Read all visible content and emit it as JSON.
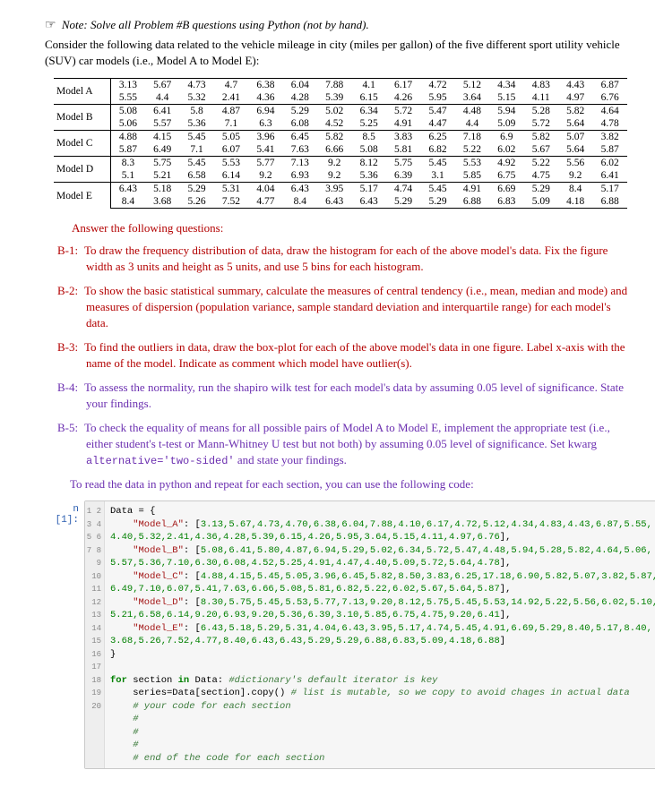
{
  "note": "Note: Solve all Problem #B questions using Python (not by hand).",
  "intro": "Consider the following data related to the vehicle mileage in city (miles per gallon) of the five different sport utility vehicle (SUV) car models (i.e., Model A to Model E):",
  "table": {
    "rows": [
      {
        "label": "Model A",
        "r1": [
          "3.13",
          "5.67",
          "4.73",
          "4.7",
          "6.38",
          "6.04",
          "7.88",
          "4.1",
          "6.17",
          "4.72",
          "5.12",
          "4.34",
          "4.83",
          "4.43",
          "6.87"
        ],
        "r2": [
          "5.55",
          "4.4",
          "5.32",
          "2.41",
          "4.36",
          "4.28",
          "5.39",
          "6.15",
          "4.26",
          "5.95",
          "3.64",
          "5.15",
          "4.11",
          "4.97",
          "6.76"
        ]
      },
      {
        "label": "Model B",
        "r1": [
          "5.08",
          "6.41",
          "5.8",
          "4.87",
          "6.94",
          "5.29",
          "5.02",
          "6.34",
          "5.72",
          "5.47",
          "4.48",
          "5.94",
          "5.28",
          "5.82",
          "4.64"
        ],
        "r2": [
          "5.06",
          "5.57",
          "5.36",
          "7.1",
          "6.3",
          "6.08",
          "4.52",
          "5.25",
          "4.91",
          "4.47",
          "4.4",
          "5.09",
          "5.72",
          "5.64",
          "4.78"
        ]
      },
      {
        "label": "Model C",
        "r1": [
          "4.88",
          "4.15",
          "5.45",
          "5.05",
          "3.96",
          "6.45",
          "5.82",
          "8.5",
          "3.83",
          "6.25",
          "7.18",
          "6.9",
          "5.82",
          "5.07",
          "3.82"
        ],
        "r2": [
          "5.87",
          "6.49",
          "7.1",
          "6.07",
          "5.41",
          "7.63",
          "6.66",
          "5.08",
          "5.81",
          "6.82",
          "5.22",
          "6.02",
          "5.67",
          "5.64",
          "5.87"
        ]
      },
      {
        "label": "Model D",
        "r1": [
          "8.3",
          "5.75",
          "5.45",
          "5.53",
          "5.77",
          "7.13",
          "9.2",
          "8.12",
          "5.75",
          "5.45",
          "5.53",
          "4.92",
          "5.22",
          "5.56",
          "6.02"
        ],
        "r2": [
          "5.1",
          "5.21",
          "6.58",
          "6.14",
          "9.2",
          "6.93",
          "9.2",
          "5.36",
          "6.39",
          "3.1",
          "5.85",
          "6.75",
          "4.75",
          "9.2",
          "6.41"
        ]
      },
      {
        "label": "Model E",
        "r1": [
          "6.43",
          "5.18",
          "5.29",
          "5.31",
          "4.04",
          "6.43",
          "3.95",
          "5.17",
          "4.74",
          "5.45",
          "4.91",
          "6.69",
          "5.29",
          "8.4",
          "5.17"
        ],
        "r2": [
          "8.4",
          "3.68",
          "5.26",
          "7.52",
          "4.77",
          "8.4",
          "6.43",
          "6.43",
          "5.29",
          "5.29",
          "6.88",
          "6.83",
          "5.09",
          "4.18",
          "6.88"
        ]
      }
    ]
  },
  "answer_header": "Answer the following questions:",
  "questions": [
    {
      "id": "B-1:",
      "cls": "q-red",
      "text": "To draw the frequency distribution of data, draw the histogram for each of the above model's data. Fix the figure width as 3 units and height as 5 units, and use 5 bins for each histogram."
    },
    {
      "id": "B-2:",
      "cls": "q-red",
      "text": "To show the basic statistical summary, calculate the measures of central tendency (i.e., mean, median and mode) and measures of dispersion (population variance, sample standard deviation and interquartile range) for each model's data."
    },
    {
      "id": "B-3:",
      "cls": "q-red",
      "text": "To find the outliers in data, draw the box-plot for each of the above model's data in one figure. Label x-axis with the name of the model. Indicate as comment which model have outlier(s)."
    },
    {
      "id": "B-4:",
      "cls": "q-purple",
      "text": "To assess the normality, run the shapiro wilk test for each model's data by assuming 0.05 level of significance. State your findings."
    },
    {
      "id": "B-5:",
      "cls": "q-purple",
      "text": "To check the equality of means for all possible pairs of Model A to Model E, implement the appropriate test (i.e., either student's t-test or Mann-Whitney U test but not both) by assuming 0.05 level of significance. Set kwarg alternative='two-sided' and state your findings."
    }
  ],
  "read_hint": "To read the data in python and repeat for each section, you can use the following code:",
  "cell_prompt": "n [1]:",
  "gutter_count": 20,
  "code": {
    "l1": "Data = {",
    "l2a": "    \"Model_A\"",
    "l2b": ": [",
    "l2c": "3.13,5.67,4.73,4.70,6.38,6.04,7.88,4.10,6.17,4.72,5.12,4.34,4.83,4.43,6.87,5.55,",
    "l3": "4.40,5.32,2.41,4.36,4.28,5.39,6.15,4.26,5.95,3.64,5.15,4.11,4.97,6.76",
    "l4a": "    \"Model_B\"",
    "l4b": ": [",
    "l4c": "5.08,6.41,5.80,4.87,6.94,5.29,5.02,6.34,5.72,5.47,4.48,5.94,5.28,5.82,4.64,5.06,",
    "l5": "5.57,5.36,7.10,6.30,6.08,4.52,5.25,4.91,4.47,4.40,5.09,5.72,5.64,4.78",
    "l6a": "    \"Model_C\"",
    "l6b": ": [",
    "l6c": "4.88,4.15,5.45,5.05,3.96,6.45,5.82,8.50,3.83,6.25,17.18,6.90,5.82,5.07,3.82,5.87,",
    "l7": "6.49,7.10,6.07,5.41,7.63,6.66,5.08,5.81,6.82,5.22,6.02,5.67,5.64,5.87",
    "l8a": "    \"Model_D\"",
    "l8b": ": [",
    "l8c": "8.30,5.75,5.45,5.53,5.77,7.13,9.20,8.12,5.75,5.45,5.53,14.92,5.22,5.56,6.02,5.10,",
    "l9": "5.21,6.58,6.14,9.20,6.93,9.20,5.36,6.39,3.10,5.85,6.75,4.75,9.20,6.41",
    "l10a": "    \"Model_E\"",
    "l10b": ": [",
    "l10c": "6.43,5.18,5.29,5.31,4.04,6.43,3.95,5.17,4.74,5.45,4.91,6.69,5.29,8.40,5.17,8.40,",
    "l11": "3.68,5.26,7.52,4.77,8.40,6.43,6.43,5.29,5.29,6.88,6.83,5.09,4.18,6.88",
    "l12": "}",
    "l13": "",
    "l14a": "for",
    "l14b": " section ",
    "l14c": "in",
    "l14d": " Data: ",
    "l14e": "#dictionary's default iterator is key",
    "l15a": "    series=Data[section].copy() ",
    "l15b": "# list is mutable, so we copy to avoid chages in actual data",
    "l16": "    # your code for each section",
    "l17": "    #",
    "l18": "    #",
    "l19": "    #",
    "l20": "    # end of the code for each section"
  }
}
